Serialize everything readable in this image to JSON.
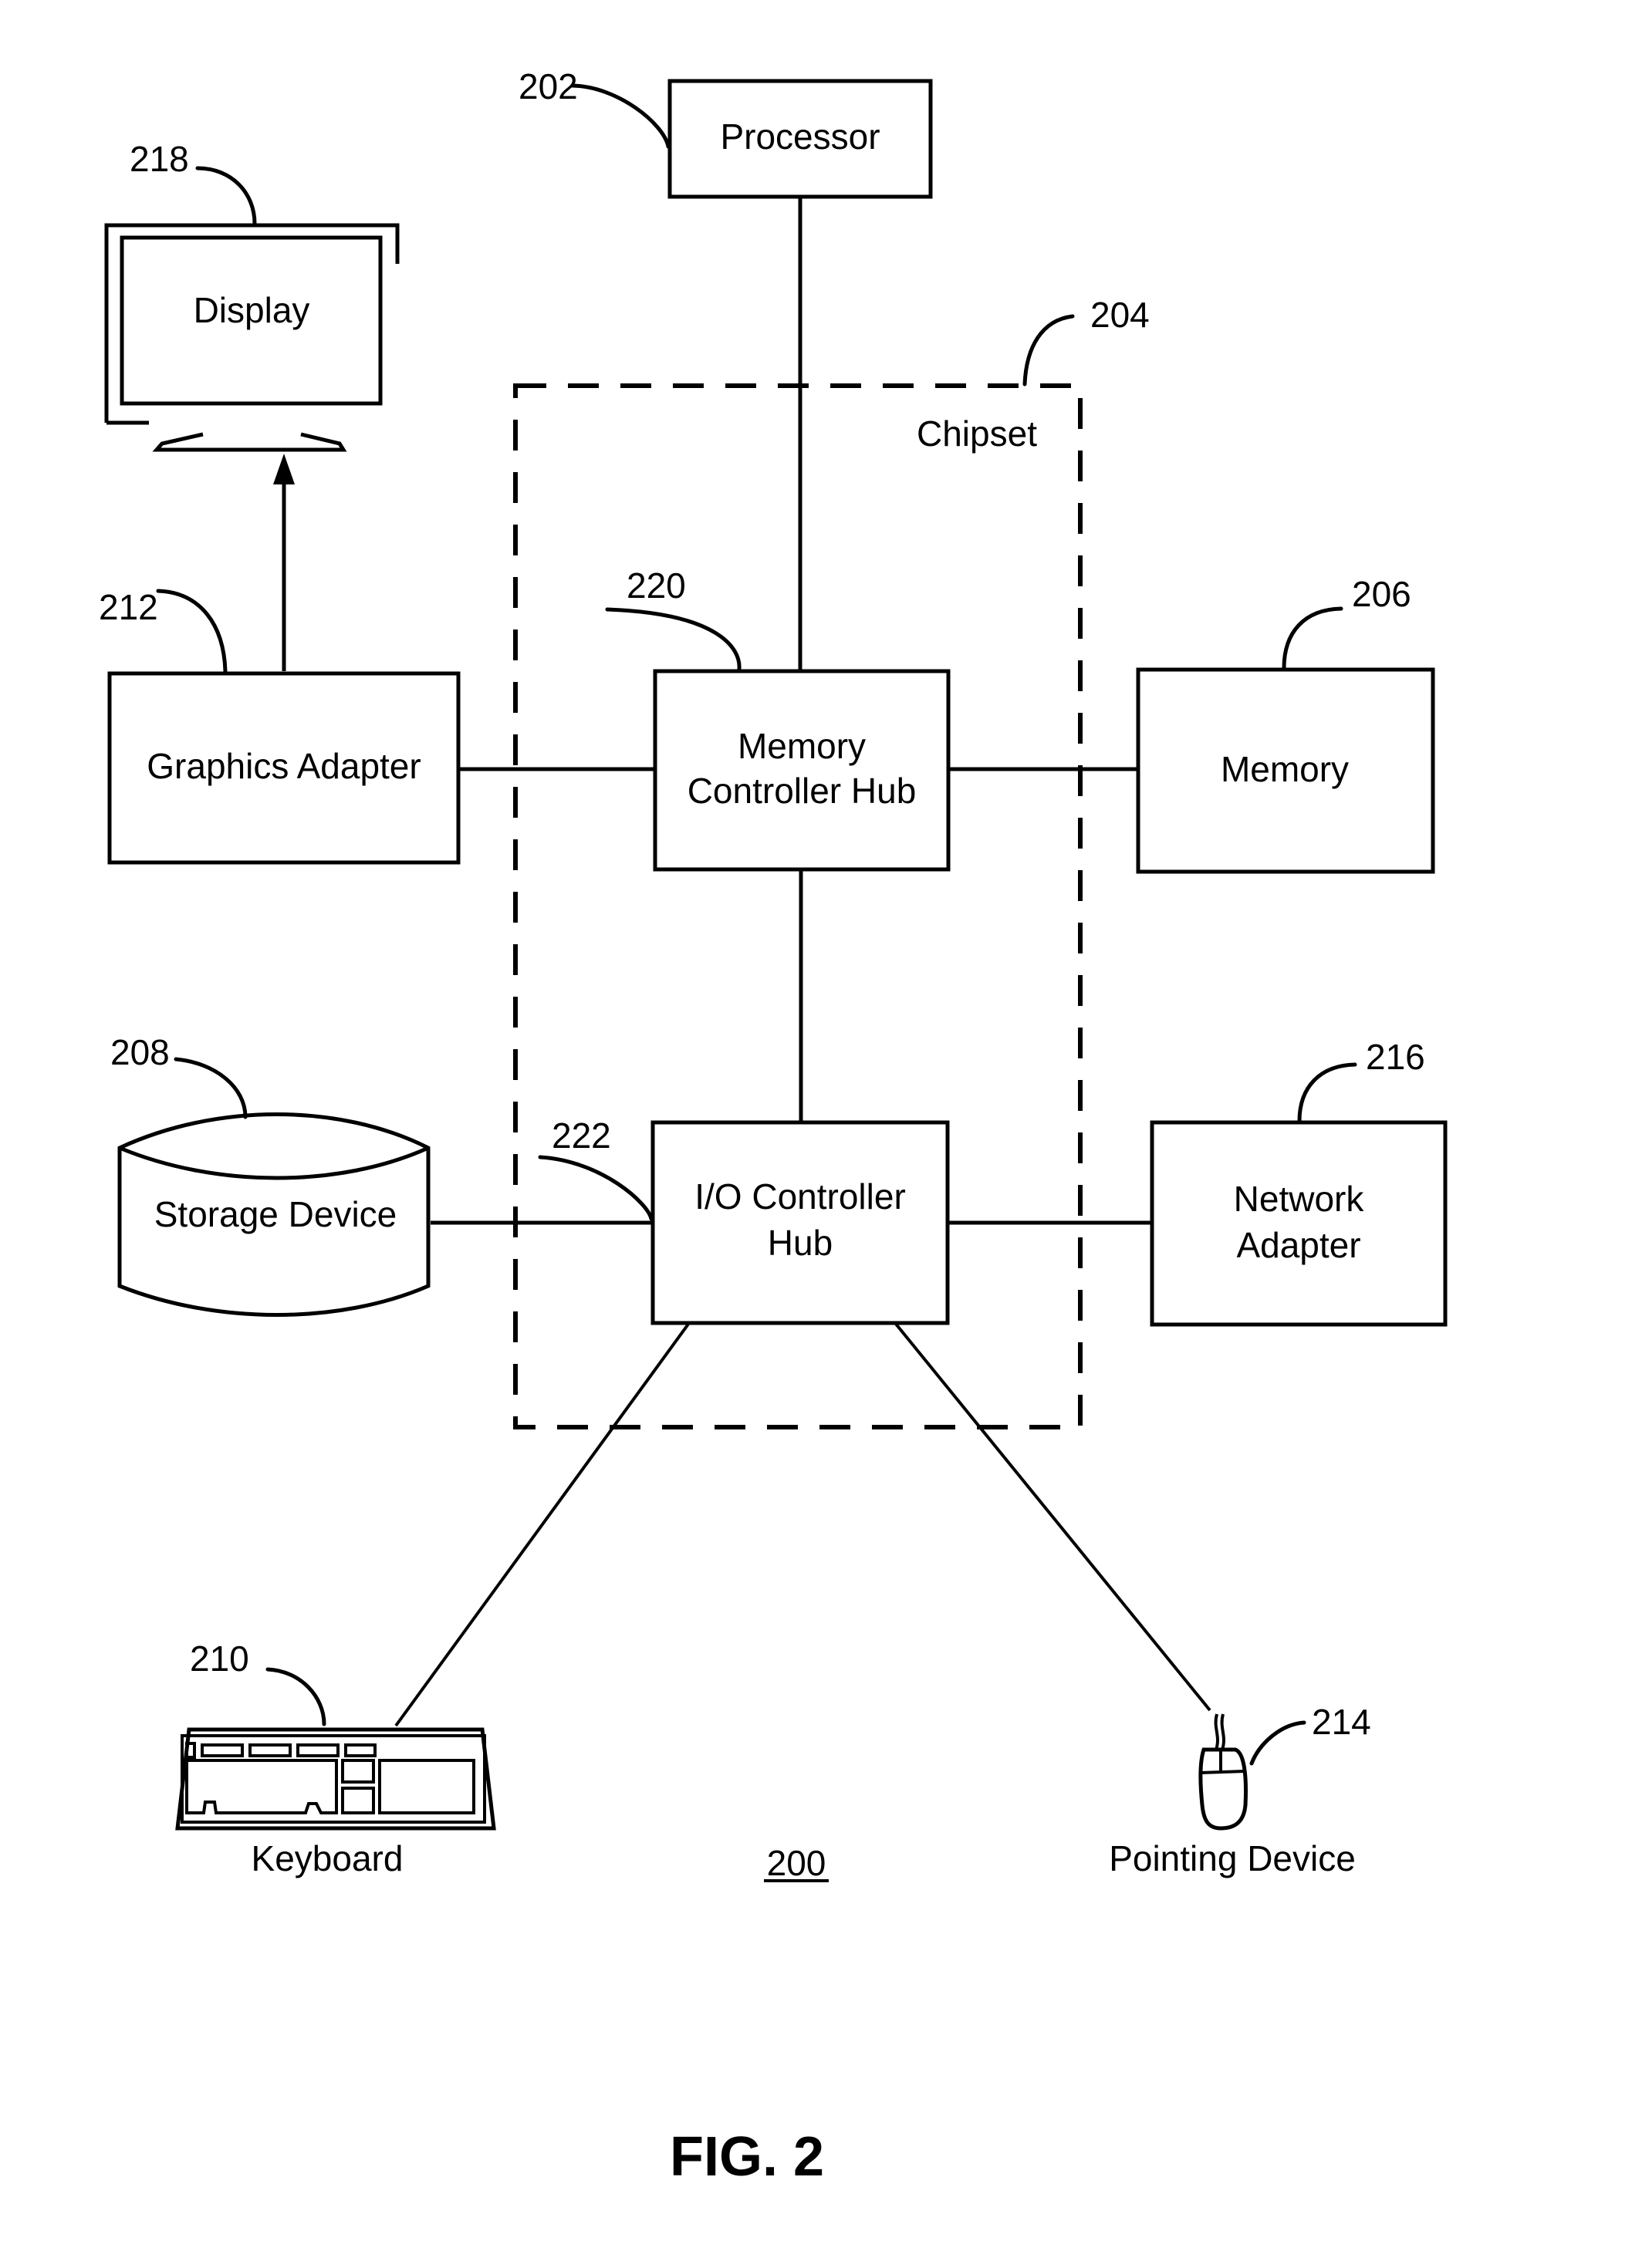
{
  "figure": {
    "title": "FIG. 2",
    "system_ref": "200"
  },
  "components": {
    "processor": {
      "label": "Processor",
      "ref": "202"
    },
    "chipset": {
      "label": "Chipset",
      "ref": "204"
    },
    "memory": {
      "label": "Memory",
      "ref": "206"
    },
    "storage": {
      "label": "Storage Device",
      "ref": "208"
    },
    "keyboard": {
      "label": "Keyboard",
      "ref": "210"
    },
    "graphics": {
      "label": "Graphics Adapter",
      "ref": "212"
    },
    "pointing": {
      "label": "Pointing Device",
      "ref": "214"
    },
    "network": {
      "label_line1": "Network",
      "label_line2": "Adapter",
      "ref": "216"
    },
    "display": {
      "label": "Display",
      "ref": "218"
    },
    "mch": {
      "label_line1": "Memory",
      "label_line2": "Controller Hub",
      "ref": "220"
    },
    "ioch": {
      "label_line1": "I/O Controller",
      "label_line2": "Hub",
      "ref": "222"
    }
  },
  "connections": [
    [
      "processor",
      "mch"
    ],
    [
      "graphics",
      "mch"
    ],
    [
      "mch",
      "memory"
    ],
    [
      "mch",
      "ioch"
    ],
    [
      "storage",
      "ioch"
    ],
    [
      "ioch",
      "network"
    ],
    [
      "ioch",
      "keyboard"
    ],
    [
      "ioch",
      "pointing"
    ],
    [
      "graphics",
      "display"
    ]
  ]
}
